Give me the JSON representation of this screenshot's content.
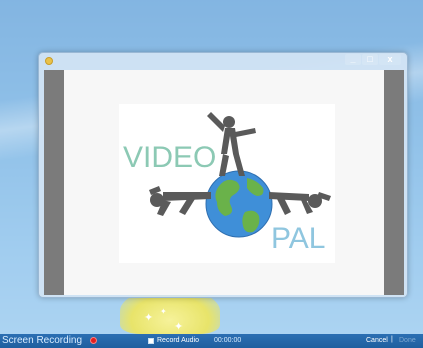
{
  "window": {
    "minimize_glyph": "_",
    "maximize_glyph": "□",
    "close_glyph": "x"
  },
  "logo": {
    "text_top": "VIDEO",
    "text_bottom": "PAL"
  },
  "status_bar": {
    "title": "Screen Recording",
    "record_audio_label": "Record Audio",
    "timer": "00:00:00",
    "cancel_label": "Cancel",
    "separator": "|",
    "done_label": "Done"
  },
  "colors": {
    "logo_text": "#8cc9b4",
    "record_dot": "#e21f1f",
    "status_bar": "#2468aa",
    "figure_gray": "#5a5a5a",
    "globe_blue": "#3f8fd8",
    "globe_green": "#6ab24a"
  },
  "icons": [
    "app-icon",
    "minimize-icon",
    "maximize-icon",
    "close-icon",
    "record-icon",
    "checkbox-icon",
    "sparkle-icon"
  ]
}
